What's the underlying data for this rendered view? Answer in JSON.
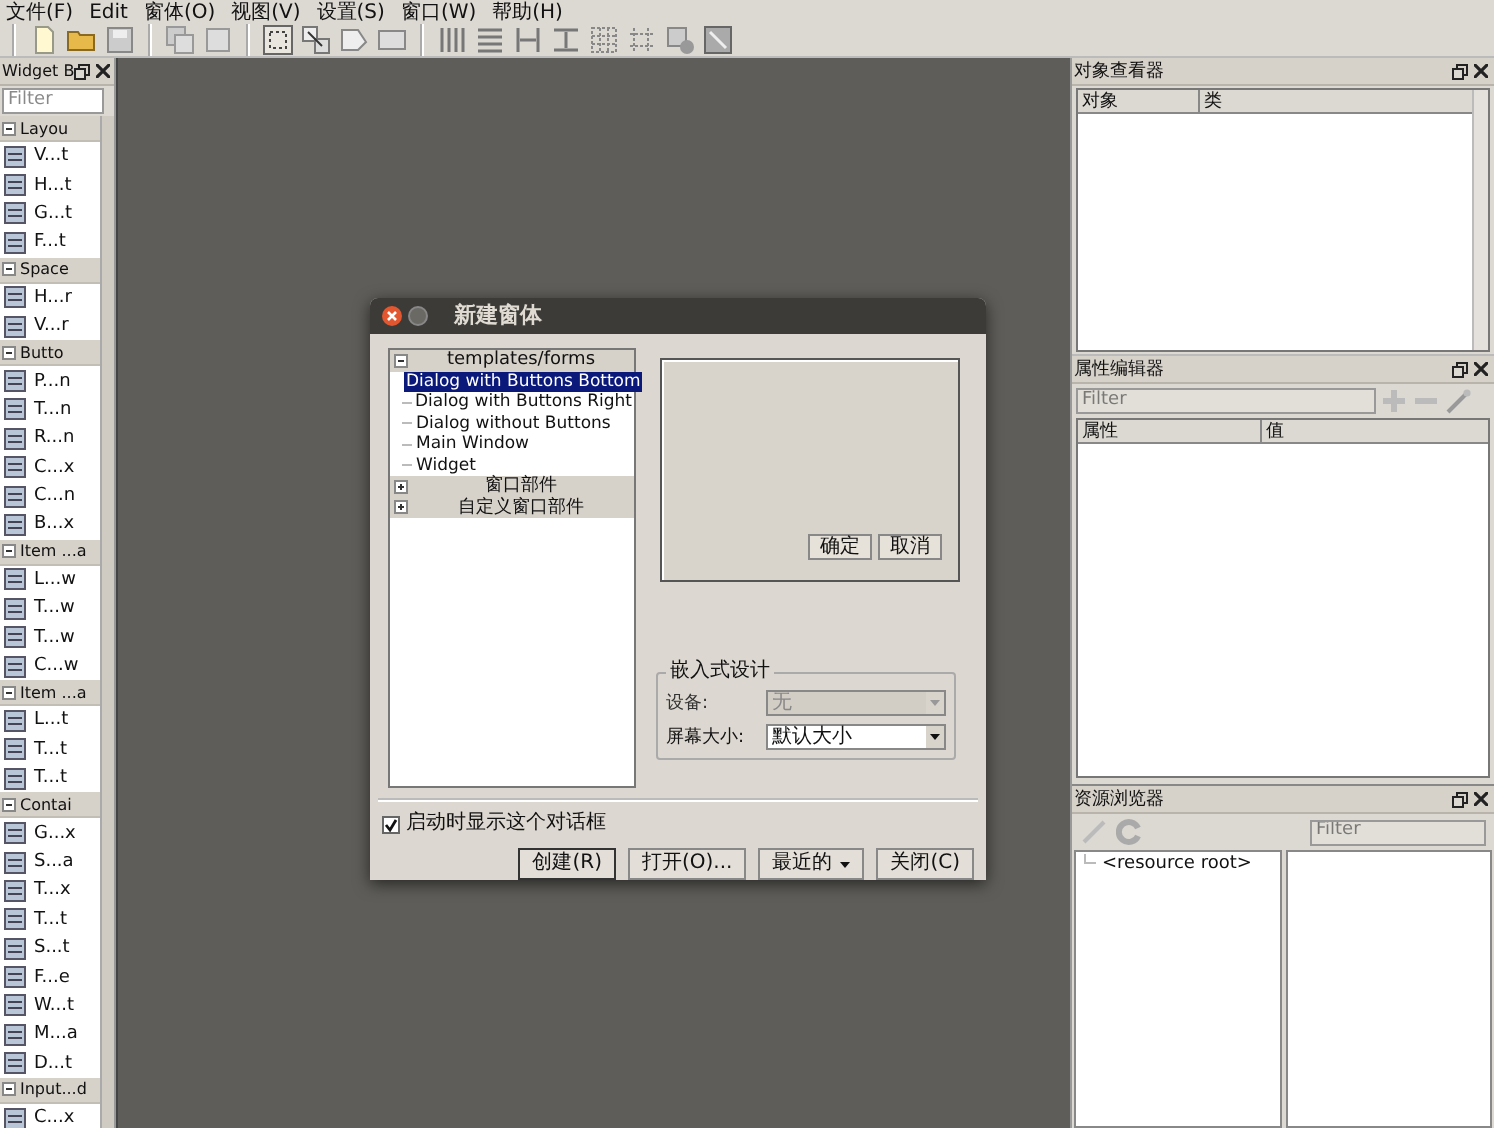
{
  "menu": [
    {
      "label": "文件(F)"
    },
    {
      "label": "Edit"
    },
    {
      "label": "窗体(O)"
    },
    {
      "label": "视图(V)"
    },
    {
      "label": "设置(S)"
    },
    {
      "label": "窗口(W)"
    },
    {
      "label": "帮助(H)"
    }
  ],
  "widget_box": {
    "title": "Widget B",
    "filter_placeholder": "Filter",
    "sections": [
      {
        "title": "Layou",
        "expanded": true,
        "items": [
          "V...t",
          "H...t",
          "G...t",
          "F...t"
        ]
      },
      {
        "title": "Space",
        "expanded": true,
        "items": [
          "H...r",
          "V...r"
        ]
      },
      {
        "title": "Butto",
        "expanded": true,
        "items": [
          "P...n",
          "T...n",
          "R...n",
          "C...x",
          "C...n",
          "B...x"
        ]
      },
      {
        "title": "Item ...a",
        "expanded": true,
        "items": [
          "L...w",
          "T...w",
          "T...w",
          "C...w"
        ]
      },
      {
        "title": "Item ...a",
        "expanded": true,
        "items": [
          "L...t",
          "T...t",
          "T...t"
        ]
      },
      {
        "title": "Contai",
        "expanded": true,
        "items": [
          "G...x",
          "S...a",
          "T...x",
          "T...t",
          "S...t",
          "F...e",
          "W...t",
          "M...a",
          "D...t"
        ]
      },
      {
        "title": "Input...d",
        "expanded": true,
        "items": [
          "C...x"
        ]
      }
    ]
  },
  "dialog": {
    "title": "新建窗体",
    "tree": [
      {
        "label": "templates/forms",
        "expanded": true,
        "children": [
          {
            "label": "Dialog with Buttons Bottom",
            "selected": true
          },
          {
            "label": "Dialog with Buttons Right",
            "selected": false
          },
          {
            "label": "Dialog without Buttons",
            "selected": false
          },
          {
            "label": "Main Window",
            "selected": false
          },
          {
            "label": "Widget",
            "selected": false
          }
        ]
      },
      {
        "label": "窗口部件",
        "expanded": false
      },
      {
        "label": "自定义窗口部件",
        "expanded": false
      }
    ],
    "preview_buttons": [
      "确定",
      "取消"
    ],
    "embedded": {
      "title": "嵌入式设计",
      "fields": [
        {
          "label": "设备:",
          "value": "无",
          "disabled": true
        },
        {
          "label": "屏幕大小:",
          "value": "默认大小",
          "disabled": false
        }
      ]
    },
    "show_on_startup": {
      "label": "启动时显示这个对话框",
      "checked": true
    },
    "buttons": [
      {
        "label": "创建(R)",
        "kind": "default"
      },
      {
        "label": "打开(O)...",
        "kind": "plain"
      },
      {
        "label": "最近的",
        "kind": "menu"
      },
      {
        "label": "关闭(C)",
        "kind": "plain"
      }
    ]
  },
  "object_inspector": {
    "title": "对象查看器",
    "columns": [
      "对象",
      "类"
    ]
  },
  "property_editor": {
    "title": "属性编辑器",
    "filter_placeholder": "Filter",
    "columns": [
      "属性",
      "值"
    ]
  },
  "resource_browser": {
    "title": "资源浏览器",
    "filter_placeholder": "Filter",
    "root": "<resource root>"
  }
}
